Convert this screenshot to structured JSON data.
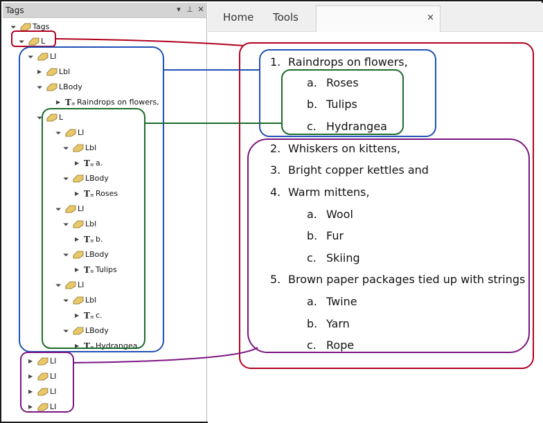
{
  "tags_panel": {
    "title": "Tags",
    "pin_label": "▾",
    "pin2_label": "⊥",
    "close_label": "✕",
    "tree": [
      {
        "label": "Tags",
        "type": "tag",
        "expanded": true
      },
      {
        "label": "L",
        "type": "tag",
        "expanded": true
      },
      {
        "label": "LI",
        "type": "tag",
        "expanded": true
      },
      {
        "label": "Lbl",
        "type": "tag",
        "expanded": false
      },
      {
        "label": "LBody",
        "type": "tag",
        "expanded": true
      },
      {
        "label": "Raindrops on flowers,",
        "type": "text",
        "expanded": false
      },
      {
        "label": "L",
        "type": "tag",
        "expanded": true
      },
      {
        "label": "LI",
        "type": "tag",
        "expanded": true
      },
      {
        "label": "Lbl",
        "type": "tag",
        "expanded": true
      },
      {
        "label": "a.",
        "type": "text",
        "expanded": false
      },
      {
        "label": "LBody",
        "type": "tag",
        "expanded": true
      },
      {
        "label": "Roses",
        "type": "text",
        "expanded": false
      },
      {
        "label": "LI",
        "type": "tag",
        "expanded": true
      },
      {
        "label": "Lbl",
        "type": "tag",
        "expanded": true
      },
      {
        "label": "b.",
        "type": "text",
        "expanded": false
      },
      {
        "label": "LBody",
        "type": "tag",
        "expanded": true
      },
      {
        "label": "Tulips",
        "type": "text",
        "expanded": false
      },
      {
        "label": "LI",
        "type": "tag",
        "expanded": true
      },
      {
        "label": "Lbl",
        "type": "tag",
        "expanded": true
      },
      {
        "label": "c.",
        "type": "text",
        "expanded": false
      },
      {
        "label": "LBody",
        "type": "tag",
        "expanded": true
      },
      {
        "label": "Hydrangea",
        "type": "text",
        "expanded": false
      },
      {
        "label": "LI",
        "type": "tag",
        "expanded": false
      },
      {
        "label": "LI",
        "type": "tag",
        "expanded": false
      },
      {
        "label": "LI",
        "type": "tag",
        "expanded": false
      },
      {
        "label": "LI",
        "type": "tag",
        "expanded": false
      }
    ]
  },
  "ribbon": {
    "tabs": [
      "Home",
      "Tools"
    ],
    "close_label": "×"
  },
  "document": {
    "lines": [
      {
        "num": "1.",
        "text": "Raindrops on flowers,"
      },
      {
        "num": "a.",
        "text": "Roses"
      },
      {
        "num": "b.",
        "text": "Tulips"
      },
      {
        "num": "c.",
        "text": "Hydrangea"
      },
      {
        "num": "2.",
        "text": "Whiskers on kittens,"
      },
      {
        "num": "3.",
        "text": "Bright copper kettles and"
      },
      {
        "num": "4.",
        "text": "Warm mittens,"
      },
      {
        "num": "a.",
        "text": "Wool"
      },
      {
        "num": "b.",
        "text": "Fur"
      },
      {
        "num": "c.",
        "text": "Skiing"
      },
      {
        "num": "5.",
        "text": "Brown paper packages tied up with strings"
      },
      {
        "num": "a.",
        "text": "Twine"
      },
      {
        "num": "b.",
        "text": "Yarn"
      },
      {
        "num": "c.",
        "text": "Rope"
      }
    ]
  },
  "colors": {
    "red": "#b00020",
    "blue": "#1f4fb5",
    "green": "#1b6b2a",
    "purple": "#7a1480",
    "tag_icon": "#e8c86a"
  }
}
